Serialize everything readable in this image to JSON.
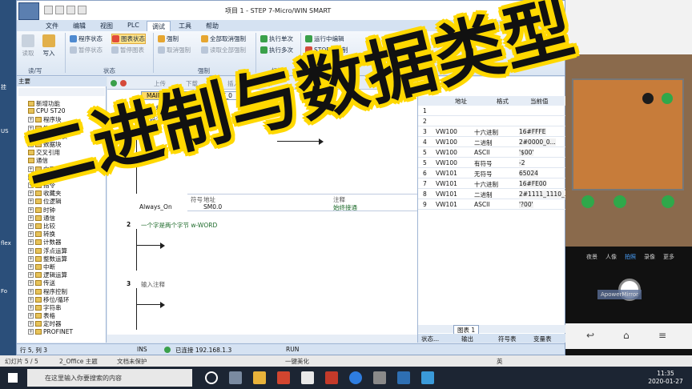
{
  "desktop_labels": [
    "挂",
    "US",
    "flex",
    "Fo"
  ],
  "window": {
    "title": "项目 1 - STEP 7-Micro/WIN SMART",
    "controls": [
      "—",
      "☐",
      "✕"
    ]
  },
  "menu": [
    "文件",
    "编辑",
    "视图",
    "PLC",
    "调试",
    "工具",
    "帮助"
  ],
  "ribbon": {
    "read": "读取",
    "write": "写入",
    "program_status": "程序状态",
    "pause_program_status": "暂停状态",
    "chart_status": "图表状态",
    "pause_chart": "暂停图表",
    "force": "强制",
    "unforce": "取消强制",
    "unforce_all": "全部取消强制",
    "read_all_forced": "读取全部强制",
    "single_scan": "执行单次",
    "multi_scan": "执行多次",
    "run_edit": "运行中编辑",
    "stop_download": "STOP下强制",
    "groups": [
      "读/写",
      "状态",
      "强制",
      "扫描",
      "设置"
    ]
  },
  "tree": {
    "header": "主要",
    "items": [
      {
        "label": "新增功能",
        "expandable": false
      },
      {
        "label": "CPU ST20",
        "expandable": false
      },
      {
        "label": "程序块",
        "expandable": true
      },
      {
        "label": "符号表",
        "expandable": true
      },
      {
        "label": "状态图表",
        "expandable": true
      },
      {
        "label": "数据块",
        "expandable": true
      },
      {
        "label": "交叉引用",
        "expandable": false
      },
      {
        "label": "通信",
        "expandable": false
      },
      {
        "label": "向导",
        "expandable": true
      },
      {
        "label": "工具",
        "expandable": true
      },
      {
        "label": "指令",
        "expandable": true
      },
      {
        "label": "收藏夹",
        "expandable": true
      },
      {
        "label": "位逻辑",
        "expandable": true
      },
      {
        "label": "时钟",
        "expandable": true
      },
      {
        "label": "通信",
        "expandable": true
      },
      {
        "label": "比较",
        "expandable": true
      },
      {
        "label": "转换",
        "expandable": true
      },
      {
        "label": "计数器",
        "expandable": true
      },
      {
        "label": "浮点运算",
        "expandable": true
      },
      {
        "label": "整数运算",
        "expandable": true
      },
      {
        "label": "中断",
        "expandable": true
      },
      {
        "label": "逻辑运算",
        "expandable": true
      },
      {
        "label": "传送",
        "expandable": true
      },
      {
        "label": "程序控制",
        "expandable": true
      },
      {
        "label": "移位/循环",
        "expandable": true
      },
      {
        "label": "字符串",
        "expandable": true
      },
      {
        "label": "表格",
        "expandable": true
      },
      {
        "label": "定时器",
        "expandable": true
      },
      {
        "label": "PROFINET",
        "expandable": true
      }
    ]
  },
  "editor": {
    "toolbar": [
      "上传",
      "下载",
      "插入",
      "删除"
    ],
    "tabs": [
      "MAIN",
      "SBR_0",
      "INT_0"
    ],
    "program_comment": "程序注释",
    "net1_comment": "程序段注释",
    "symbol_header": "符号",
    "address_header": "地址",
    "comment_header": "注释",
    "symbol_row": {
      "symbol": "Always_On",
      "address": "SM0.0",
      "comment": "始终接通"
    },
    "net2_comment": "一个字是两个字节 w-WORD",
    "net3_comment": "输入注释",
    "net_numbers": [
      "1",
      "2",
      "3"
    ]
  },
  "chart": {
    "headers": [
      "",
      "地址",
      "格式",
      "当前值"
    ],
    "rows": [
      {
        "n": "1",
        "addr": "",
        "fmt": "",
        "val": ""
      },
      {
        "n": "2",
        "addr": "",
        "fmt": "",
        "val": ""
      },
      {
        "n": "3",
        "addr": "VW100",
        "fmt": "十六进制",
        "val": "16#FFFE"
      },
      {
        "n": "4",
        "addr": "VW100",
        "fmt": "二进制",
        "val": "2#0000_0..."
      },
      {
        "n": "5",
        "addr": "VW100",
        "fmt": "ASCII",
        "val": "'$00'"
      },
      {
        "n": "5",
        "addr": "VW100",
        "fmt": "有符号",
        "val": "-2"
      },
      {
        "n": "6",
        "addr": "VW101",
        "fmt": "无符号",
        "val": "65024"
      },
      {
        "n": "7",
        "addr": "VW101",
        "fmt": "十六进制",
        "val": "16#FE00"
      },
      {
        "n": "8",
        "addr": "VW101",
        "fmt": "二进制",
        "val": "2#1111_1110_..."
      },
      {
        "n": "9",
        "addr": "VW101",
        "fmt": "ASCII",
        "val": "'?00'"
      }
    ],
    "sheet_tab": "图表 1",
    "bottom_tabs": [
      "状态...",
      "输出",
      "符号表",
      "变量表"
    ]
  },
  "statusbar": {
    "position": "行 5, 列 3",
    "mode": "INS",
    "connection": "已连接 192.168.1.3",
    "plc_state": "RUN"
  },
  "overlay_title": "二进制与数据类型",
  "phone": {
    "app": "ApowerMirror",
    "modes": [
      "夜景",
      "人像",
      "拍照",
      "录像",
      "更多"
    ]
  },
  "ppt_status": {
    "slide": "幻灯片 5 / 5",
    "theme": "2_Office 主题",
    "protect": "文档未保护",
    "beautify": "一键美化",
    "ime": "英"
  },
  "taskbar": {
    "search_placeholder": "在这里输入你要搜索的内容",
    "time": "11:35",
    "date": "2020-01-27"
  },
  "colors": {
    "ribbon_active": "#ffd966",
    "overlay_fill": "#111111",
    "overlay_outline": "#ffd800",
    "taskbar": "#1c2533"
  }
}
